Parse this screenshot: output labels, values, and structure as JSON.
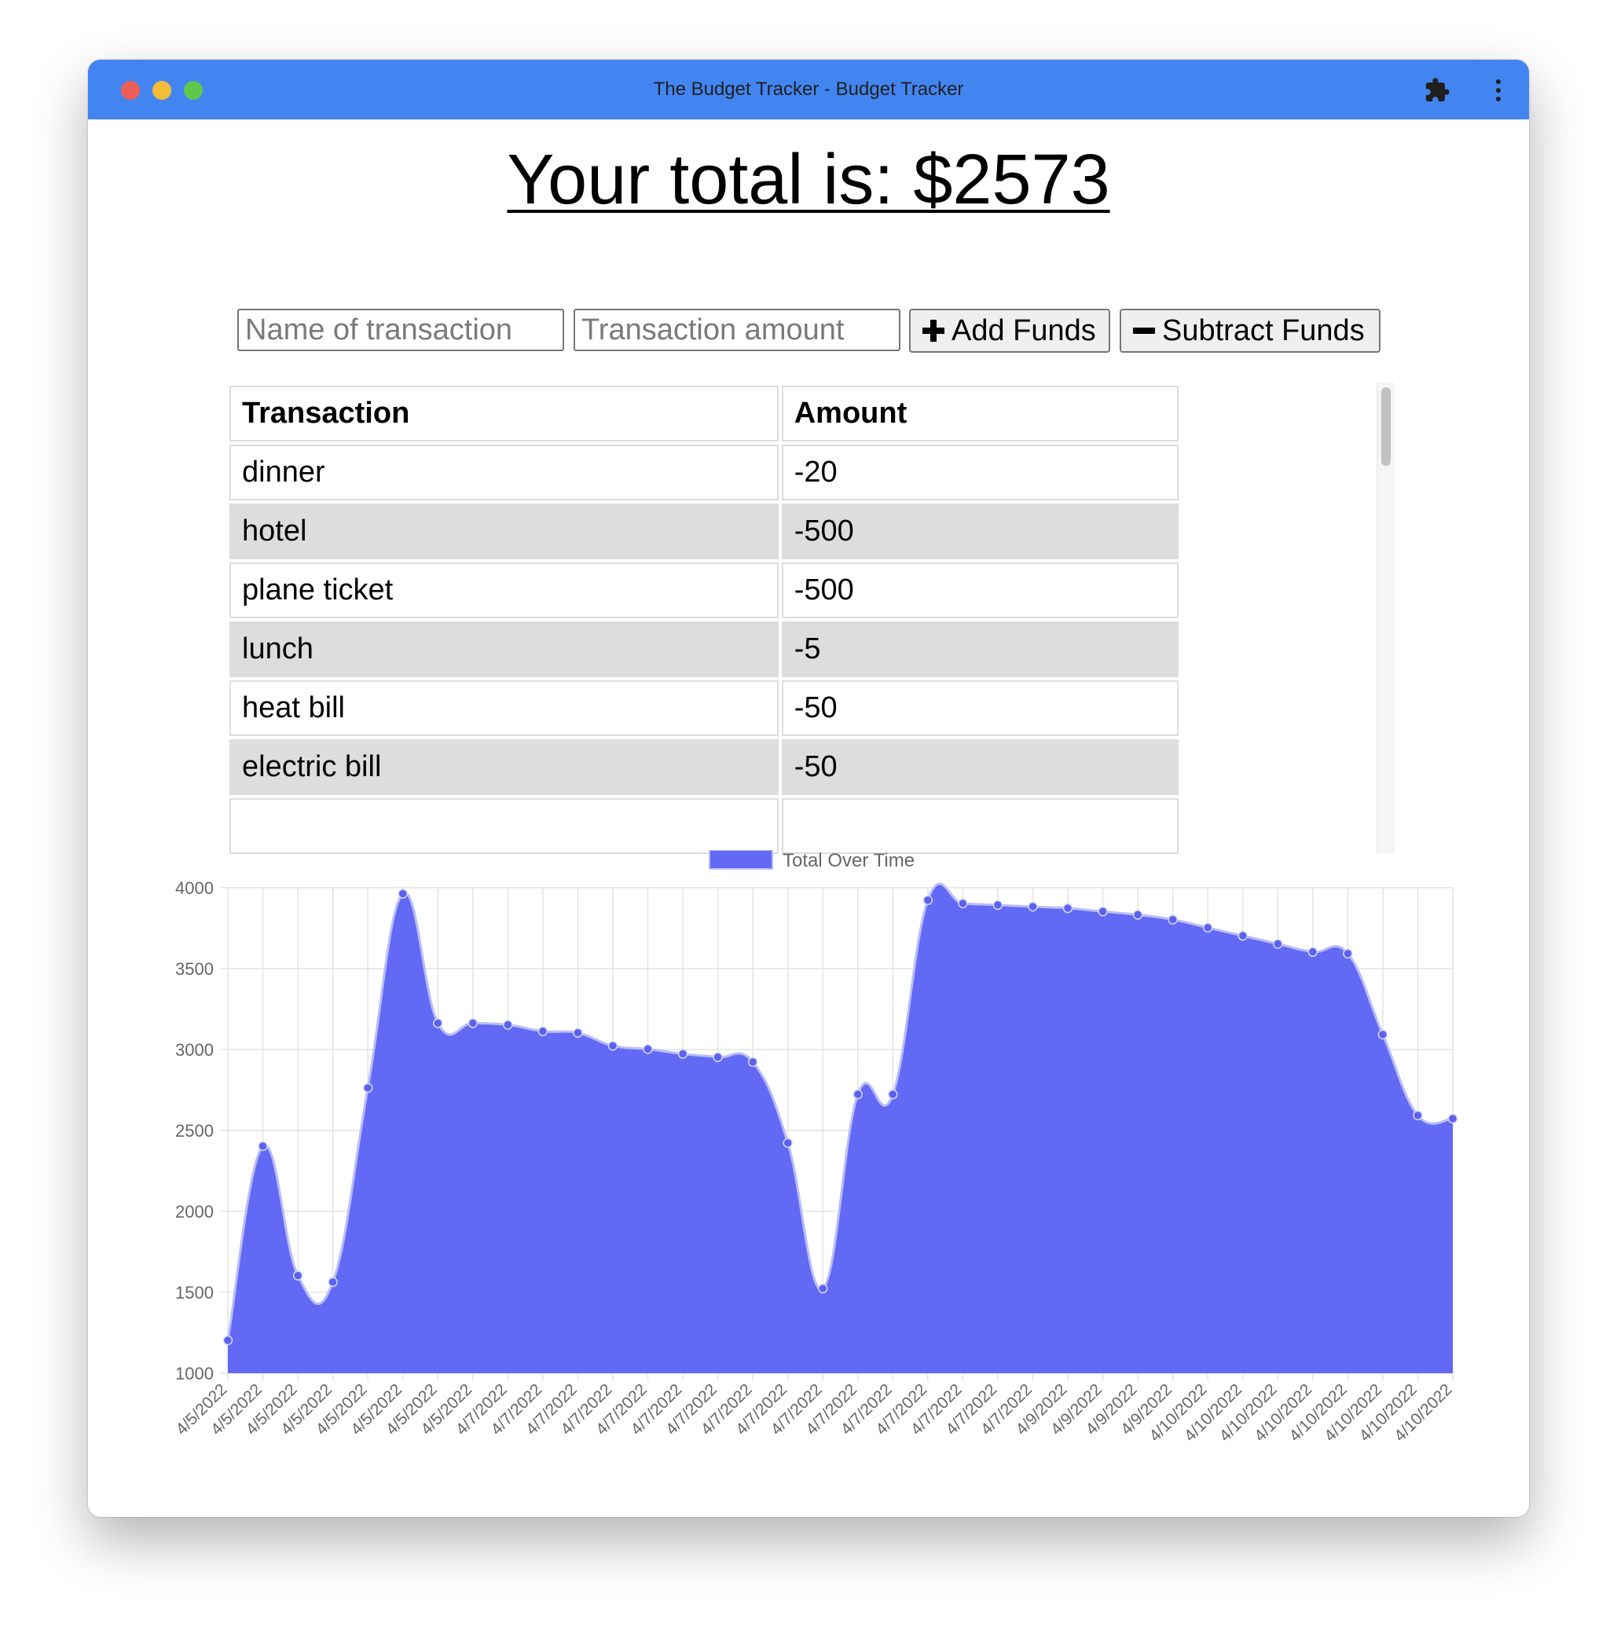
{
  "window": {
    "title": "The Budget Tracker - Budget Tracker"
  },
  "total": {
    "label": "Your total is: $2573"
  },
  "form": {
    "name_placeholder": "Name of transaction",
    "amount_placeholder": "Transaction amount",
    "add_label": "Add Funds",
    "subtract_label": "Subtract Funds"
  },
  "table": {
    "headers": [
      "Transaction",
      "Amount"
    ],
    "rows": [
      {
        "name": "dinner",
        "amount": "-20"
      },
      {
        "name": "hotel",
        "amount": "-500"
      },
      {
        "name": "plane ticket",
        "amount": "-500"
      },
      {
        "name": "lunch",
        "amount": "-5"
      },
      {
        "name": "heat bill",
        "amount": "-50"
      },
      {
        "name": "electric bill",
        "amount": "-50"
      }
    ]
  },
  "colors": {
    "titlebar": "#4285f0",
    "chart_fill": "#6269f4",
    "chart_point": "#5b62f0"
  },
  "chart_data": {
    "type": "area",
    "legend": "Total Over Time",
    "legend_position": "top",
    "grid": true,
    "ylim": [
      1000,
      4000
    ],
    "yticks": [
      4000,
      3500,
      3000,
      2500,
      2000,
      1500,
      1000
    ],
    "categories": [
      "4/5/2022",
      "4/5/2022",
      "4/5/2022",
      "4/5/2022",
      "4/5/2022",
      "4/5/2022",
      "4/5/2022",
      "4/5/2022",
      "4/7/2022",
      "4/7/2022",
      "4/7/2022",
      "4/7/2022",
      "4/7/2022",
      "4/7/2022",
      "4/7/2022",
      "4/7/2022",
      "4/7/2022",
      "4/7/2022",
      "4/7/2022",
      "4/7/2022",
      "4/7/2022",
      "4/7/2022",
      "4/7/2022",
      "4/7/2022",
      "4/9/2022",
      "4/9/2022",
      "4/9/2022",
      "4/9/2022",
      "4/10/2022",
      "4/10/2022",
      "4/10/2022",
      "4/10/2022",
      "4/10/2022",
      "4/10/2022",
      "4/10/2022",
      "4/10/2022"
    ],
    "values": [
      1203,
      2403,
      1603,
      1563,
      2763,
      3963,
      3163,
      3163,
      3153,
      3113,
      3103,
      3023,
      3003,
      2973,
      2953,
      2923,
      2423,
      1523,
      2723,
      2723,
      3923,
      3903,
      3893,
      3883,
      3873,
      3853,
      3833,
      3803,
      3753,
      3703,
      3653,
      3603,
      3593,
      3093,
      2593,
      2573
    ]
  }
}
